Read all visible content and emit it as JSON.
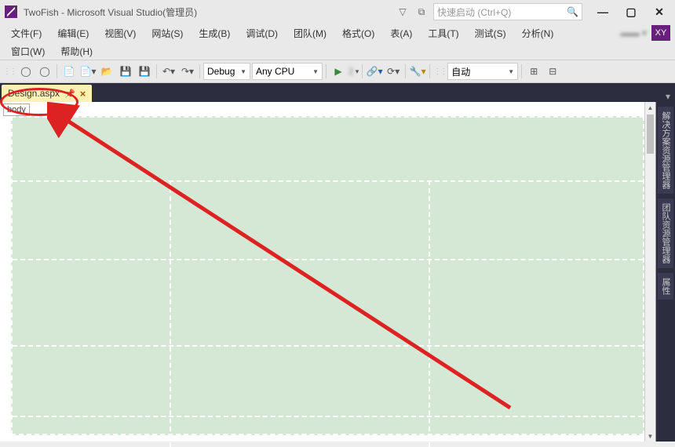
{
  "title": "TwoFish - Microsoft Visual Studio(管理员)",
  "quicklaunch_placeholder": "快速启动 (Ctrl+Q)",
  "menu": {
    "file": "文件(F)",
    "edit": "编辑(E)",
    "view": "视图(V)",
    "website": "网站(S)",
    "build": "生成(B)",
    "debug": "调试(D)",
    "team": "团队(M)",
    "format": "格式(O)",
    "table": "表(A)",
    "tools": "工具(T)",
    "test": "测试(S)",
    "analyze": "分析(N)",
    "window": "窗口(W)",
    "help": "帮助(H)"
  },
  "user_badge": "XY",
  "toolbar": {
    "config": "Debug",
    "platform": "Any CPU",
    "start_label": "2",
    "props_mode": "自动"
  },
  "tab": {
    "name": "Design.aspx"
  },
  "breadcrumb": "body",
  "side_tabs": {
    "t1": "解决方案资源管理器",
    "t2": "团队资源管理器",
    "t3": "属性"
  }
}
